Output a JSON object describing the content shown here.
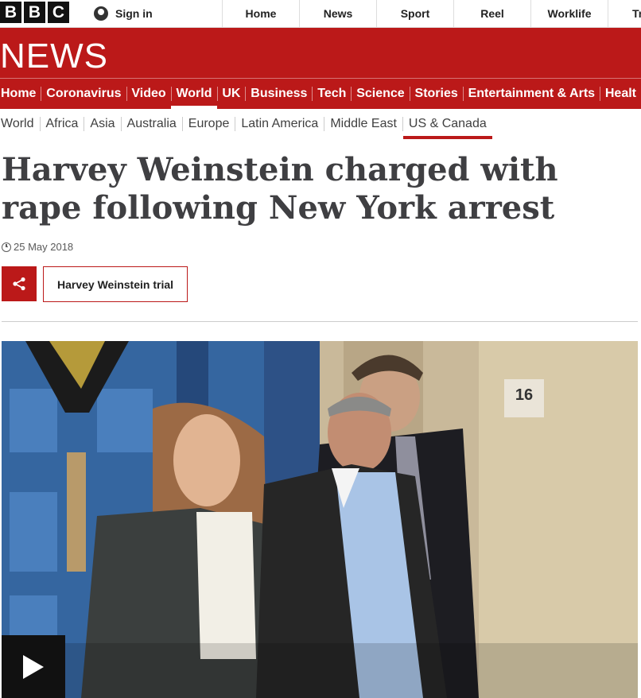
{
  "topbar": {
    "logo_letters": [
      "B",
      "B",
      "C"
    ],
    "signin_label": "Sign in",
    "nav": [
      "Home",
      "News",
      "Sport",
      "Reel",
      "Worklife",
      "Tr"
    ]
  },
  "brand": {
    "title": "NEWS",
    "accent": "#bb1919"
  },
  "section_nav": {
    "items": [
      "Home",
      "Coronavirus",
      "Video",
      "World",
      "UK",
      "Business",
      "Tech",
      "Science",
      "Stories",
      "Entertainment & Arts",
      "Healt"
    ],
    "active": "World"
  },
  "sub_nav": {
    "items": [
      "World",
      "Africa",
      "Asia",
      "Australia",
      "Europe",
      "Latin America",
      "Middle East",
      "US & Canada"
    ],
    "active": "US & Canada"
  },
  "article": {
    "headline": "Harvey Weinstein charged with rape following New York arrest",
    "date": "25 May 2018",
    "topic_tag": "Harvey Weinstein trial",
    "image_sign_number": "16"
  }
}
